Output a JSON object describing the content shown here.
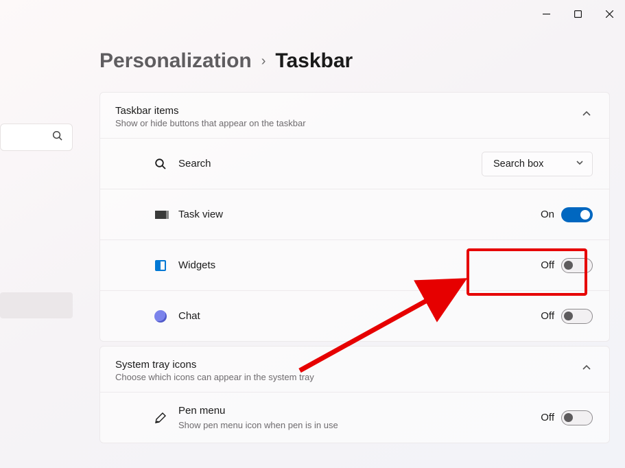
{
  "breadcrumb": {
    "parent": "Personalization",
    "current": "Taskbar"
  },
  "sections": {
    "taskbar_items": {
      "title": "Taskbar items",
      "subtitle": "Show or hide buttons that appear on the taskbar",
      "rows": {
        "search": {
          "label": "Search",
          "dropdown_value": "Search box"
        },
        "taskview": {
          "label": "Task view",
          "state": "On",
          "on": true
        },
        "widgets": {
          "label": "Widgets",
          "state": "Off",
          "on": false
        },
        "chat": {
          "label": "Chat",
          "state": "Off",
          "on": false
        }
      }
    },
    "system_tray": {
      "title": "System tray icons",
      "subtitle": "Choose which icons can appear in the system tray",
      "rows": {
        "pen_menu": {
          "label": "Pen menu",
          "sub": "Show pen menu icon when pen is in use",
          "state": "Off",
          "on": false
        }
      }
    }
  },
  "annotation": {
    "highlight_row": "widgets"
  }
}
